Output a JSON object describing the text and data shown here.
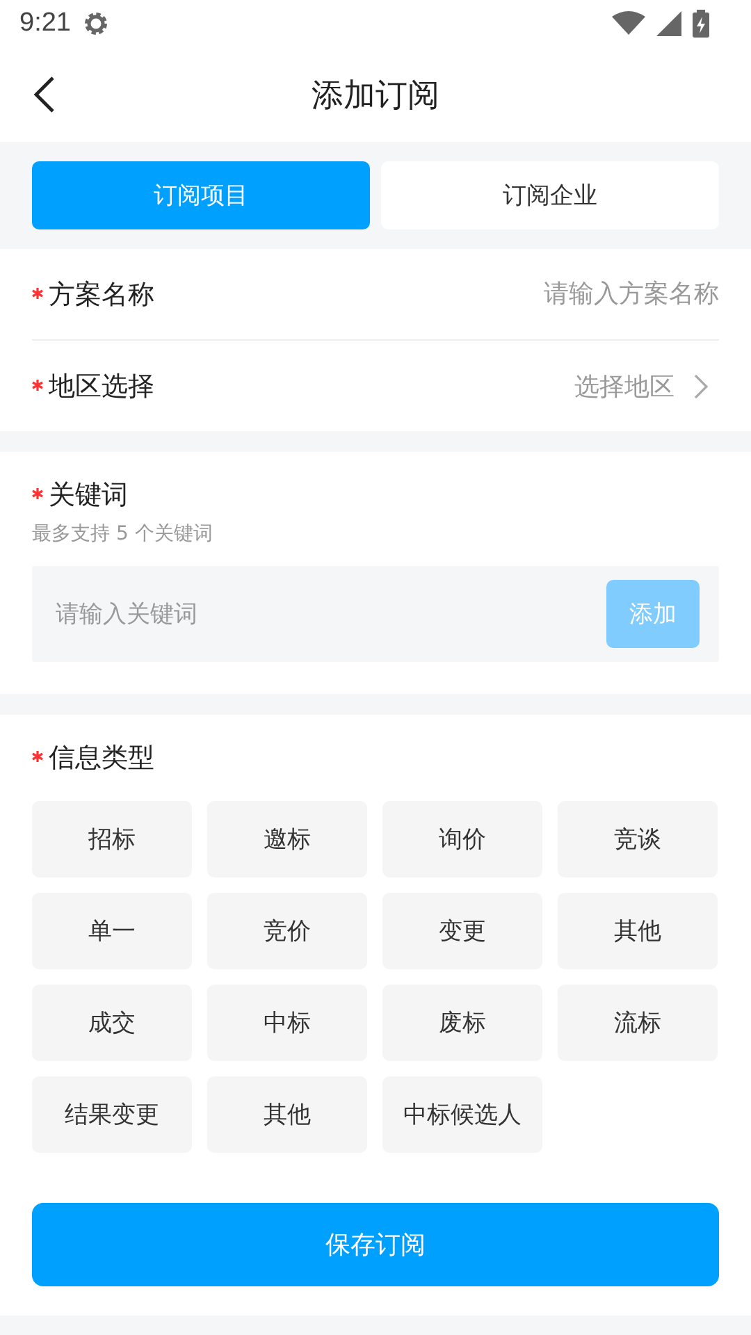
{
  "status_bar": {
    "time": "9:21"
  },
  "header": {
    "title": "添加订阅"
  },
  "tabs": [
    {
      "label": "订阅项目",
      "selected": true
    },
    {
      "label": "订阅企业",
      "selected": false
    }
  ],
  "fields": [
    {
      "kind": "input",
      "label": "方案名称",
      "required": true,
      "placeholder": "请输入方案名称"
    },
    {
      "kind": "select",
      "label": "地区选择",
      "required": true,
      "placeholder": "选择地区"
    }
  ],
  "keywords": {
    "label": "关键词",
    "required": true,
    "hint": "最多支持 5 个关键词",
    "placeholder": "请输入关键词",
    "add_button": "添加",
    "add_disabled": true
  },
  "info_types": {
    "label": "信息类型",
    "required": true,
    "options": [
      {
        "label": "招标",
        "selected": false
      },
      {
        "label": "邀标",
        "selected": false
      },
      {
        "label": "询价",
        "selected": false
      },
      {
        "label": "竞谈",
        "selected": false
      },
      {
        "label": "单一",
        "selected": false
      },
      {
        "label": "竞价",
        "selected": false
      },
      {
        "label": "变更",
        "selected": false
      },
      {
        "label": "其他",
        "selected": false
      },
      {
        "label": "成交",
        "selected": false
      },
      {
        "label": "中标",
        "selected": false
      },
      {
        "label": "废标",
        "selected": false
      },
      {
        "label": "流标",
        "selected": false
      },
      {
        "label": "结果变更",
        "selected": false
      },
      {
        "label": "其他",
        "selected": false
      },
      {
        "label": "中标候选人",
        "selected": false
      }
    ]
  },
  "save_button": "保存订阅"
}
